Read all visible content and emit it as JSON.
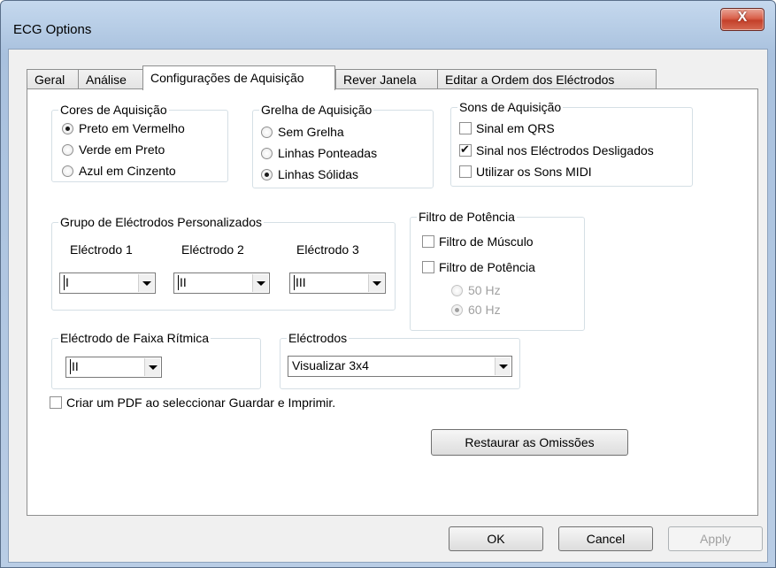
{
  "window": {
    "title": "ECG Options",
    "close_label": "X"
  },
  "tabs": [
    {
      "label": "Geral"
    },
    {
      "label": "Análise"
    },
    {
      "label": "Configurações de Aquisição"
    },
    {
      "label": "Rever Janela"
    },
    {
      "label": "Editar a Ordem dos Eléctrodos"
    }
  ],
  "active_tab": "Configurações de Aquisição",
  "cores": {
    "title": "Cores de Aquisição",
    "options": [
      {
        "label": "Preto em Vermelho",
        "selected": true
      },
      {
        "label": "Verde em Preto",
        "selected": false
      },
      {
        "label": "Azul em Cinzento",
        "selected": false
      }
    ]
  },
  "grelha": {
    "title": "Grelha de Aquisição",
    "options": [
      {
        "label": "Sem Grelha",
        "selected": false
      },
      {
        "label": "Linhas Ponteadas",
        "selected": false
      },
      {
        "label": "Linhas Sólidas",
        "selected": true
      }
    ]
  },
  "sons": {
    "title": "Sons de Aquisição",
    "options": [
      {
        "label": "Sinal em QRS",
        "checked": false
      },
      {
        "label": "Sinal nos Eléctrodos Desligados",
        "checked": true
      },
      {
        "label": "Utilizar os Sons MIDI",
        "checked": false
      }
    ]
  },
  "grupo": {
    "title": "Grupo de Eléctrodos Personalizados",
    "electrodes": [
      {
        "label": "Eléctrodo 1",
        "value": "I"
      },
      {
        "label": "Eléctrodo 2",
        "value": "II"
      },
      {
        "label": "Eléctrodo 3",
        "value": "III"
      }
    ]
  },
  "filtro": {
    "title": "Filtro de Potência",
    "checks": [
      {
        "label": "Filtro de Músculo",
        "checked": false
      },
      {
        "label": "Filtro de Potência",
        "checked": false
      }
    ],
    "freqs": [
      {
        "label": "50 Hz",
        "selected": false
      },
      {
        "label": "60 Hz",
        "selected": true
      }
    ]
  },
  "faixa": {
    "title": "Eléctrodo de Faixa Rítmica",
    "value": "II"
  },
  "electrodos": {
    "title": "Eléctrodos",
    "value": "Visualizar 3x4"
  },
  "pdf": {
    "label": "Criar um PDF ao seleccionar Guardar e Imprimir.",
    "checked": false
  },
  "restore_label": "Restaurar as Omissões",
  "buttons": {
    "ok": "OK",
    "cancel": "Cancel",
    "apply": "Apply"
  }
}
